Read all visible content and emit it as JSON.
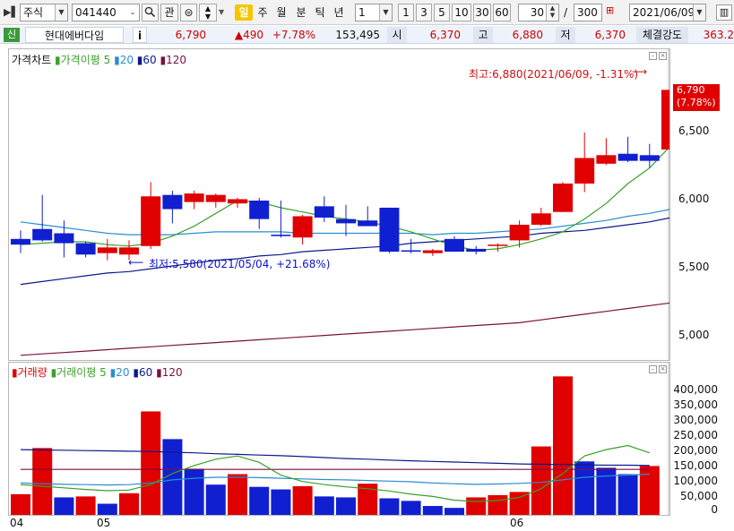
{
  "toolbar": {
    "market_select": "주식",
    "code_input": "041440",
    "btn_gwan": "관",
    "btn_today": "일",
    "periods": [
      "주",
      "월",
      "분",
      "틱",
      "년"
    ],
    "interval_select": "1",
    "interval_buttons": [
      "1",
      "3",
      "5",
      "10",
      "30",
      "60"
    ],
    "count_value": "30",
    "count_sep": "/",
    "count_total": "300",
    "date_select": "2021/06/09"
  },
  "quote": {
    "badge": "신",
    "name": "현대에버다임",
    "info": "i",
    "price": "6,790",
    "change": "▲490",
    "rate": "+7.78%",
    "volume": "153,495",
    "open_label": "시",
    "open": "6,370",
    "high_label": "고",
    "high": "6,880",
    "low_label": "저",
    "low": "6,370",
    "strength_label": "체결강도",
    "strength": "363.2"
  },
  "price_panel": {
    "legend_title": "가격차트",
    "legend_ma": "가격이평",
    "legend_ma_periods": [
      "5",
      "20",
      "60",
      "120"
    ],
    "y_ticks": [
      "6,500",
      "6,000",
      "5,500",
      "5,000"
    ],
    "current_price": "6,790",
    "current_rate": "(7.78%)",
    "high_note": "최고:6,880(2021/06/09, -1.31%)",
    "low_note": "최저:5,580(2021/05/04, +21.68%)"
  },
  "volume_panel": {
    "legend_title": "거래량",
    "legend_ma": "거래이평",
    "legend_ma_periods": [
      "5",
      "20",
      "60",
      "120"
    ],
    "y_ticks": [
      "400,000",
      "350,000",
      "300,000",
      "250,000",
      "200,000",
      "150,000",
      "100,000",
      "50,000",
      "0"
    ],
    "x_ticks": [
      "04",
      "05",
      "06"
    ]
  },
  "colors": {
    "up": "#e00000",
    "down": "#1020d0",
    "ma5": "#3aa02a",
    "ma20": "#2a8ed0",
    "ma60": "#0a1a8a",
    "ma120": "#7a1040",
    "note_red": "#cc1010",
    "note_blue": "#1010cc"
  },
  "chart_data": {
    "type": "candlestick",
    "x_labels": [
      "04",
      "05",
      "06"
    ],
    "candles": [
      {
        "o": 5740,
        "h": 5800,
        "l": 5640,
        "c": 5700
      },
      {
        "o": 5810,
        "h": 6050,
        "l": 5720,
        "c": 5730
      },
      {
        "o": 5780,
        "h": 5870,
        "l": 5610,
        "c": 5710
      },
      {
        "o": 5710,
        "h": 5720,
        "l": 5610,
        "c": 5630
      },
      {
        "o": 5640,
        "h": 5740,
        "l": 5590,
        "c": 5680
      },
      {
        "o": 5630,
        "h": 5730,
        "l": 5590,
        "c": 5680
      },
      {
        "o": 5690,
        "h": 6140,
        "l": 5670,
        "c": 6040
      },
      {
        "o": 6050,
        "h": 6080,
        "l": 5850,
        "c": 5950
      },
      {
        "o": 6000,
        "h": 6080,
        "l": 5950,
        "c": 6060
      },
      {
        "o": 6000,
        "h": 6060,
        "l": 5960,
        "c": 6050
      },
      {
        "o": 5990,
        "h": 6030,
        "l": 5960,
        "c": 6020
      },
      {
        "o": 6010,
        "h": 6030,
        "l": 5810,
        "c": 5880
      },
      {
        "o": 5770,
        "h": 6010,
        "l": 5750,
        "c": 5760
      },
      {
        "o": 5750,
        "h": 5910,
        "l": 5700,
        "c": 5900
      },
      {
        "o": 5970,
        "h": 6040,
        "l": 5860,
        "c": 5890
      },
      {
        "o": 5880,
        "h": 5980,
        "l": 5760,
        "c": 5850
      },
      {
        "o": 5870,
        "h": 5970,
        "l": 5830,
        "c": 5830
      },
      {
        "o": 5960,
        "h": 5960,
        "l": 5640,
        "c": 5650
      },
      {
        "o": 5660,
        "h": 5740,
        "l": 5640,
        "c": 5650
      },
      {
        "o": 5640,
        "h": 5670,
        "l": 5620,
        "c": 5660
      },
      {
        "o": 5740,
        "h": 5760,
        "l": 5650,
        "c": 5650
      },
      {
        "o": 5670,
        "h": 5690,
        "l": 5630,
        "c": 5650
      },
      {
        "o": 5700,
        "h": 5710,
        "l": 5650,
        "c": 5700
      },
      {
        "o": 5730,
        "h": 5870,
        "l": 5680,
        "c": 5840
      },
      {
        "o": 5840,
        "h": 5960,
        "l": 5830,
        "c": 5920
      },
      {
        "o": 5930,
        "h": 6140,
        "l": 5930,
        "c": 6130
      },
      {
        "o": 6130,
        "h": 6490,
        "l": 6070,
        "c": 6310
      },
      {
        "o": 6270,
        "h": 6450,
        "l": 6260,
        "c": 6330
      },
      {
        "o": 6340,
        "h": 6460,
        "l": 6280,
        "c": 6290
      },
      {
        "o": 6330,
        "h": 6410,
        "l": 6240,
        "c": 6290
      },
      {
        "o": 6370,
        "h": 6880,
        "l": 6370,
        "c": 6790
      }
    ],
    "ma5": [
      5700,
      5710,
      5720,
      5720,
      5700,
      5690,
      5710,
      5760,
      5830,
      5920,
      6010,
      6000,
      5960,
      5930,
      5900,
      5880,
      5860,
      5830,
      5790,
      5740,
      5690,
      5660,
      5670,
      5700,
      5740,
      5790,
      5880,
      5990,
      6130,
      6240,
      6400
    ],
    "ma20": [
      5860,
      5840,
      5820,
      5800,
      5780,
      5770,
      5770,
      5770,
      5780,
      5790,
      5790,
      5790,
      5790,
      5780,
      5780,
      5780,
      5780,
      5780,
      5780,
      5770,
      5780,
      5780,
      5790,
      5800,
      5810,
      5830,
      5850,
      5870,
      5900,
      5920,
      5950
    ],
    "ma60": [
      5420,
      5440,
      5460,
      5480,
      5500,
      5510,
      5530,
      5550,
      5570,
      5590,
      5600,
      5620,
      5630,
      5650,
      5660,
      5670,
      5680,
      5690,
      5710,
      5720,
      5730,
      5740,
      5750,
      5760,
      5780,
      5790,
      5800,
      5820,
      5840,
      5860,
      5890
    ],
    "ma120": [
      4920,
      4930,
      4940,
      4950,
      4960,
      4970,
      4980,
      4990,
      5000,
      5010,
      5020,
      5030,
      5040,
      5050,
      5060,
      5070,
      5080,
      5090,
      5100,
      5110,
      5120,
      5130,
      5140,
      5150,
      5170,
      5190,
      5210,
      5230,
      5250,
      5270,
      5290
    ],
    "volume": [
      65000,
      210000,
      55000,
      58000,
      35000,
      68000,
      325000,
      238000,
      145000,
      95000,
      128000,
      88000,
      80000,
      90000,
      58000,
      55000,
      98000,
      52000,
      44000,
      28000,
      22000,
      55000,
      62000,
      72000,
      215000,
      435000,
      168000,
      148000,
      128000,
      153495
    ],
    "volume_up": [
      true,
      true,
      false,
      true,
      false,
      true,
      true,
      false,
      false,
      false,
      true,
      false,
      false,
      true,
      false,
      false,
      true,
      false,
      false,
      false,
      false,
      true,
      true,
      true,
      true,
      true,
      false,
      false,
      false,
      true
    ],
    "vol_ma5": [
      95000,
      90000,
      85000,
      80000,
      76000,
      78000,
      95000,
      130000,
      155000,
      175000,
      185000,
      165000,
      125000,
      105000,
      95000,
      88000,
      82000,
      75000,
      65000,
      58000,
      46000,
      42000,
      45000,
      55000,
      82000,
      130000,
      185000,
      205000,
      218000,
      195000
    ],
    "vol_ma20": [
      100000,
      98000,
      96000,
      95000,
      94000,
      95000,
      100000,
      110000,
      115000,
      118000,
      118000,
      117000,
      115000,
      113000,
      111000,
      110000,
      108000,
      106000,
      104000,
      100000,
      98000,
      96000,
      97000,
      99000,
      102000,
      110000,
      118000,
      122000,
      125000,
      128000
    ],
    "vol_ma60": [
      205000,
      204000,
      203000,
      202000,
      201000,
      200000,
      199000,
      197000,
      195000,
      192000,
      190000,
      188000,
      186000,
      183000,
      180000,
      177000,
      175000,
      172000,
      170000,
      168000,
      166000,
      164000,
      162000,
      160000,
      159000,
      158000,
      157000,
      156000,
      156000,
      155000
    ],
    "vol_ma120": [
      143000,
      143000,
      143000,
      143000,
      143000,
      143000,
      143000,
      143000,
      143000,
      143000,
      143000,
      143000,
      143000,
      143000,
      143000,
      143000,
      143000,
      143000,
      143000,
      143000,
      143000,
      143000,
      143000,
      143000,
      143000,
      143000,
      143000,
      143000,
      143000,
      143000
    ],
    "ylim_price": [
      4900,
      6950
    ],
    "ylim_volume": [
      0,
      450000
    ]
  }
}
